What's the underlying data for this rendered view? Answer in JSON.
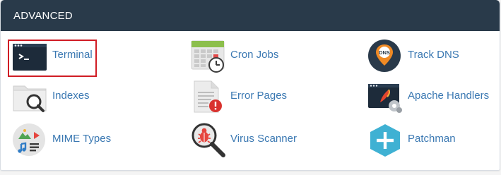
{
  "section": {
    "title": "ADVANCED"
  },
  "items": [
    {
      "label": "Terminal",
      "icon": "terminal-icon"
    },
    {
      "label": "Cron Jobs",
      "icon": "calendar-clock-icon"
    },
    {
      "label": "Track DNS",
      "icon": "dns-pin-icon"
    },
    {
      "label": "Indexes",
      "icon": "folder-search-icon"
    },
    {
      "label": "Error Pages",
      "icon": "document-error-icon"
    },
    {
      "label": "Apache Handlers",
      "icon": "apache-feather-icon"
    },
    {
      "label": "MIME Types",
      "icon": "media-types-icon"
    },
    {
      "label": "Virus Scanner",
      "icon": "bug-magnifier-icon"
    },
    {
      "label": "Patchman",
      "icon": "hexagon-plus-icon"
    }
  ],
  "selected_item": "Terminal",
  "colors": {
    "header_bg": "#293a4a",
    "link": "#3a78b2",
    "highlight_border": "#d01c24"
  }
}
